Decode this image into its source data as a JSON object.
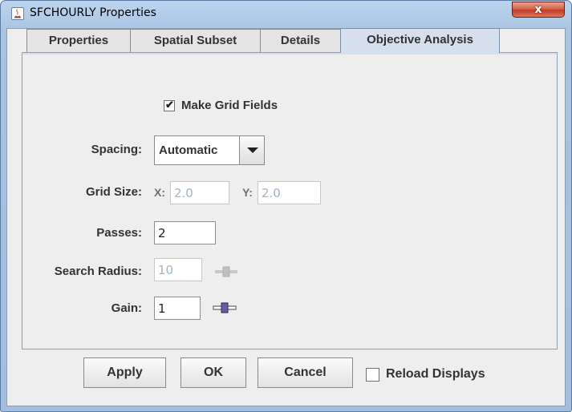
{
  "window": {
    "title": "SFCHOURLY Properties",
    "close_label": "x"
  },
  "tabs": [
    {
      "label": "Properties"
    },
    {
      "label": "Spatial Subset"
    },
    {
      "label": "Details"
    },
    {
      "label": "Objective Analysis",
      "active": true
    }
  ],
  "form": {
    "make_grid": {
      "label": "Make Grid Fields",
      "checked": true,
      "mark": "✔"
    },
    "spacing": {
      "label": "Spacing:",
      "value": "Automatic"
    },
    "grid_size": {
      "label": "Grid Size:",
      "x_label": "X:",
      "x_value": "2.0",
      "y_label": "Y:",
      "y_value": "2.0"
    },
    "passes": {
      "label": "Passes:",
      "value": "2"
    },
    "search_radius": {
      "label": "Search Radius:",
      "value": "10"
    },
    "gain": {
      "label": "Gain:",
      "value": "1"
    }
  },
  "buttons": {
    "apply": "Apply",
    "ok": "OK",
    "cancel": "Cancel",
    "reload": {
      "label": "Reload Displays",
      "checked": false
    }
  },
  "colors": {
    "title_bar": "#a9c3e2",
    "close_button": "#c23b22",
    "active_tab": "#d5dfee"
  }
}
